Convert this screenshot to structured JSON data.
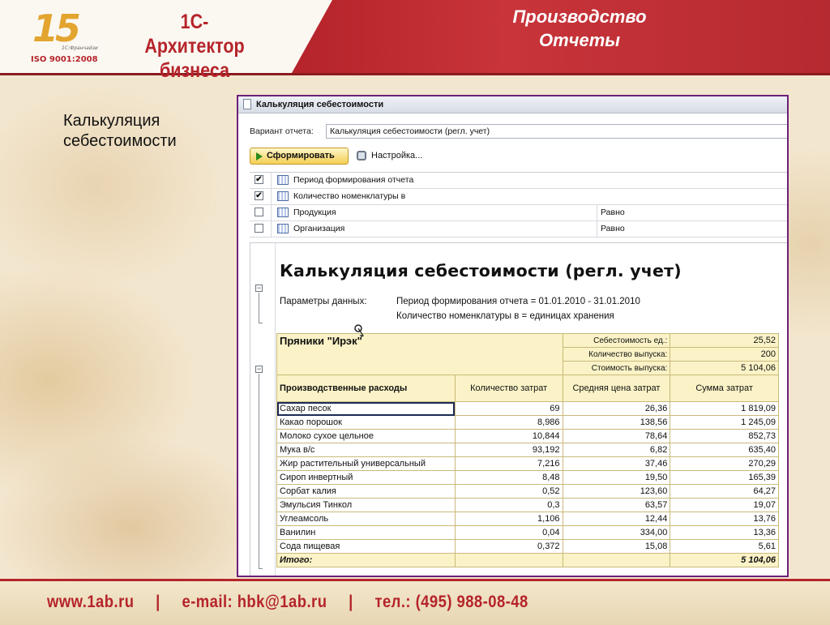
{
  "header": {
    "logo_number": "15",
    "logo_small": "1С:Франчайзи",
    "logo_iso": "ISO 9001:2008",
    "brand_line1": "1С-Архитектор",
    "brand_line2": "бизнеса",
    "section_line1": "Производство",
    "section_line2": "Отчеты"
  },
  "slide_title_line1": "Калькуляция",
  "slide_title_line2": "себестоимости",
  "window": {
    "title": "Калькуляция себестоимости",
    "variant_label": "Вариант отчета:",
    "variant_value": "Калькуляция себестоимости (регл. учет)",
    "form_button": "Сформировать",
    "settings_button": "Настройка...",
    "filters": [
      {
        "checked": true,
        "label": "Период формирования отчета",
        "op": ""
      },
      {
        "checked": true,
        "label": "Количество номенклатуры в",
        "op": ""
      },
      {
        "checked": false,
        "label": "Продукция",
        "op": "Равно"
      },
      {
        "checked": false,
        "label": "Организация",
        "op": "Равно"
      }
    ]
  },
  "report": {
    "title": "Калькуляция себестоимости (регл. учет)",
    "params_label": "Параметры данных:",
    "param1": "Период формирования отчета = 01.01.2010 - 31.01.2010",
    "param2": "Количество номенклатуры в = единицах хранения",
    "product": {
      "name": "Пряники \"Ирэк\"",
      "unit_cost_label": "Себестоимость ед.:",
      "unit_cost": "25,52",
      "qty_label": "Количество выпуска:",
      "qty": "200",
      "cost_label": "Стоимость выпуска:",
      "cost": "5 104,06"
    },
    "columns": [
      "Производственные расходы",
      "Количество затрат",
      "Средняя цена затрат",
      "Сумма затрат"
    ],
    "rows": [
      [
        "Сахар песок",
        "69",
        "26,36",
        "1 819,09"
      ],
      [
        "Какао порошок",
        "8,986",
        "138,56",
        "1 245,09"
      ],
      [
        "Молоко сухое цельное",
        "10,844",
        "78,64",
        "852,73"
      ],
      [
        "Мука в/с",
        "93,192",
        "6,82",
        "635,40"
      ],
      [
        "Жир растительный универсальный",
        "7,216",
        "37,46",
        "270,29"
      ],
      [
        "Сироп инвертный",
        "8,48",
        "19,50",
        "165,39"
      ],
      [
        "Сорбат калия",
        "0,52",
        "123,60",
        "64,27"
      ],
      [
        "Эмульсия Тинкол",
        "0,3",
        "63,57",
        "19,07"
      ],
      [
        "Углеамсоль",
        "1,106",
        "12,44",
        "13,76"
      ],
      [
        "Ванилин",
        "0,04",
        "334,00",
        "13,36"
      ],
      [
        "Сода пищевая",
        "0,372",
        "15,08",
        "5,61"
      ]
    ],
    "total_label": "Итого:",
    "total_value": "5 104,06"
  },
  "footer": {
    "site": "www.1ab.ru",
    "sep": "|",
    "email": "e-mail: hbk@1ab.ru",
    "phone": "тел.: (495) 988-08-48"
  },
  "colors": {
    "brand_red": "#b5242a",
    "accent_gold": "#e3a530",
    "table_header_bg": "#fbf3c7",
    "window_border": "#6b1f7a"
  }
}
